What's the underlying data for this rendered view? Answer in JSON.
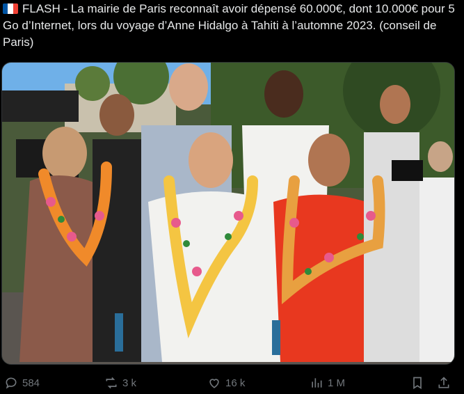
{
  "tweet": {
    "text": "FLASH - La mairie de Paris reconnaît avoir dépensé 60.000€, dont 10.000€ pour 5 Go d’Internet, lors du voyage d’Anne Hidalgo à Tahiti à l’automne 2023. (conseil de Paris)",
    "flag_icon": "france-flag-icon",
    "flag_colors": [
      "#0055a4",
      "#ffffff",
      "#ef4135"
    ]
  },
  "media": {
    "icon": "photo",
    "palette": {
      "sky": "#6fb0e8",
      "trees": "#3c5a2a",
      "road": "#5a5550",
      "red_dress": "#e8381f",
      "white_top": "#f2f2ef"
    }
  },
  "actions": {
    "replies": "584",
    "reposts": "3 k",
    "likes": "16 k",
    "views": "1 M",
    "color": "#71767b"
  }
}
